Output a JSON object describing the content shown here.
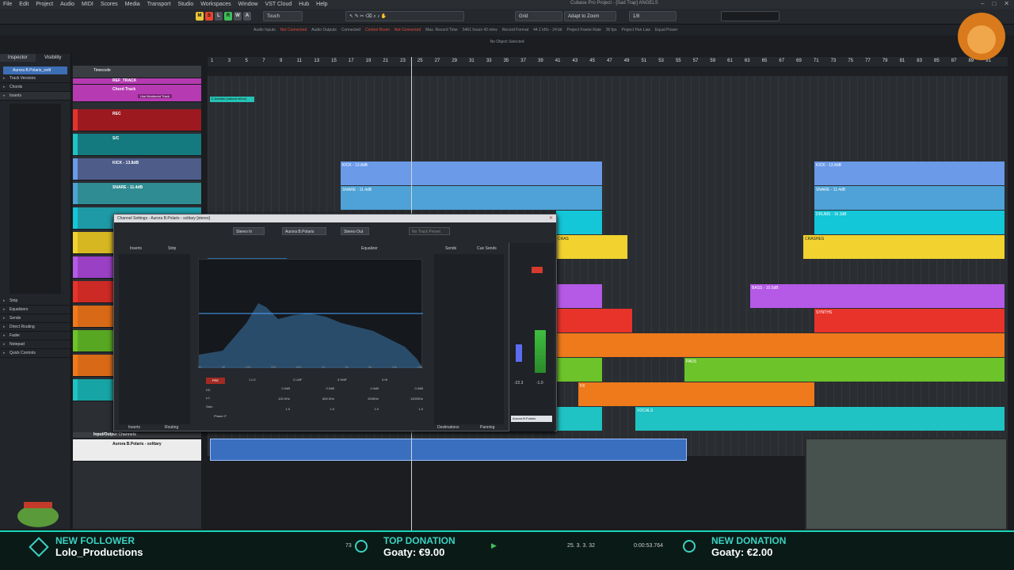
{
  "menu": [
    "File",
    "Edit",
    "Project",
    "Audio",
    "MIDI",
    "Scores",
    "Media",
    "Transport",
    "Studio",
    "Workspaces",
    "Window",
    "VST Cloud",
    "Hub",
    "Help"
  ],
  "window_title": "Cubase Pro Project - [Sad Trap] ANGELS",
  "toolbar": {
    "automation_mode": "Touch",
    "snap_type": "Grid",
    "snap_adapt": "Adapt to Zoom",
    "quantize": "1/8",
    "m_label": "M",
    "s_label": "S",
    "l_label": "L",
    "r_label": "R",
    "w_label": "W",
    "a_label": "A"
  },
  "status": {
    "audio_inputs": "Audio Inputs",
    "audio_inputs_val": "Not Connected",
    "audio_outputs": "Audio Outputs",
    "audio_outputs_val": "Connected",
    "control_room": "Control Room",
    "control_room_val": "Not Connected",
    "max_record": "Max. Record Time",
    "max_record_val": "5461 hours 43 mins",
    "record_format": "Record Format",
    "record_format_val": "44.1 kHz - 24 bit",
    "frame_rate": "Project Frame Rate",
    "frame_rate_val": "30 fps",
    "pan_law": "Project Pan Law",
    "pan_law_val": "Equal Power"
  },
  "no_selection": "No Object Selected",
  "inspector": {
    "tabs": [
      "Inspector",
      "Visibility"
    ],
    "track_name": "Aurora B.Polaris_solit",
    "sections_top": [
      "Track Versions",
      "Chords",
      "Inserts"
    ],
    "sections_bottom": [
      "Strip",
      "Equalizers",
      "Sends",
      "Direct Routing",
      "Fader",
      "Notepad",
      "Quick Controls"
    ]
  },
  "tracks": {
    "timecode": "Timecode",
    "ref": "REF_TRACK",
    "chord": "Chord Track",
    "chord_btn": "Use Monitored Track",
    "rec": "REC",
    "sc": "S/C",
    "kick": "KICK - 13.8dB",
    "snare": "SNARE - 11.4dB",
    "io_folder": "Input/Output Channels",
    "aurora": "Aurora B.Polaris - solitary"
  },
  "ruler_marks": [
    "1",
    "3",
    "5",
    "7",
    "9",
    "11",
    "13",
    "15",
    "17",
    "19",
    "21",
    "23",
    "25",
    "27",
    "29",
    "31",
    "33",
    "35",
    "37",
    "39",
    "41",
    "43",
    "45",
    "47",
    "49",
    "51",
    "53",
    "55",
    "57",
    "59",
    "61",
    "63",
    "65",
    "67",
    "69",
    "71",
    "73",
    "75",
    "77",
    "79",
    "81",
    "83",
    "85",
    "87",
    "89",
    "91"
  ],
  "chord_marker": "C Aeolian (natural minor)",
  "clips": {
    "kick": "KICK - 13.8dB",
    "snare": "SNARE - 11.4dB",
    "drums": "DRUMS - 16.3dB",
    "crashes": "CRASHES",
    "cras": "CRAS",
    "bass": "BASS - 10.5dB",
    "synths": "SYNTHS",
    "pads": "PADS",
    "fx": "FX",
    "vocals": "VOCALS",
    "voc": "VOC"
  },
  "channel_window": {
    "title": "Channel Settings - Aurora B.Polaris - solitary [stereo]",
    "input": "Stereo In",
    "channel": "Aurora B.Polaris",
    "output": "Stereo Out",
    "preset": "No Track Preset",
    "left_tabs": [
      "Inserts",
      "Strip"
    ],
    "eq_title": "Equalizer",
    "eq_header_name": "Aurora B.Polaris - solitary",
    "sends": "Sends",
    "cue_sends": "Cue Sends",
    "freq_labels": [
      "20",
      "50",
      "100",
      "200",
      "500",
      "1k",
      "2k",
      "5k",
      "10k",
      "20k"
    ],
    "bands": [
      {
        "name": "1 LO",
        "gain": "0.0dB",
        "freq": "100.0Hz",
        "q": "1.0"
      },
      {
        "name": "2 LMF",
        "gain": "0.0dB",
        "freq": "800.0Hz",
        "q": "1.0"
      },
      {
        "name": "3 HMF",
        "gain": "0.0dB",
        "freq": "2000Hz",
        "q": "1.0"
      },
      {
        "name": "4 HI",
        "gain": "0.0dB",
        "freq": "12000Hz",
        "q": "1.0"
      }
    ],
    "pre": "PRE",
    "hc": "HC",
    "lc": "LC",
    "gain": "Gain",
    "phase": "Phase 0°",
    "bottom_tabs": [
      "Inserts",
      "Routing",
      "Destinations",
      "Panning"
    ],
    "fader_value": "-22.3",
    "fader_value2": "-1.0",
    "fader_name": "Aurora B.Polaris"
  },
  "transport": {
    "position": "25. 3. 3. 32",
    "time": "0:00:53.764",
    "tempo": "73"
  },
  "stream": {
    "follower_label": "NEW FOLLOWER",
    "follower_name": "Lolo_Productions",
    "top_label": "TOP DONATION",
    "top_value": "Goaty: €9.00",
    "donation_label": "NEW DONATION",
    "donation_value": "Goaty: €2.00"
  },
  "colors": {
    "accent": "#19d4b9",
    "kick": "#6a9ae8",
    "snare": "#4ea2d7",
    "drums": "#13c6d8",
    "crash": "#f2d22f",
    "bass": "#b45ae6",
    "synth": "#e8332b",
    "pads": "#6cc32a",
    "fx": "#ee7a1c",
    "vocal": "#1fc3c3"
  }
}
